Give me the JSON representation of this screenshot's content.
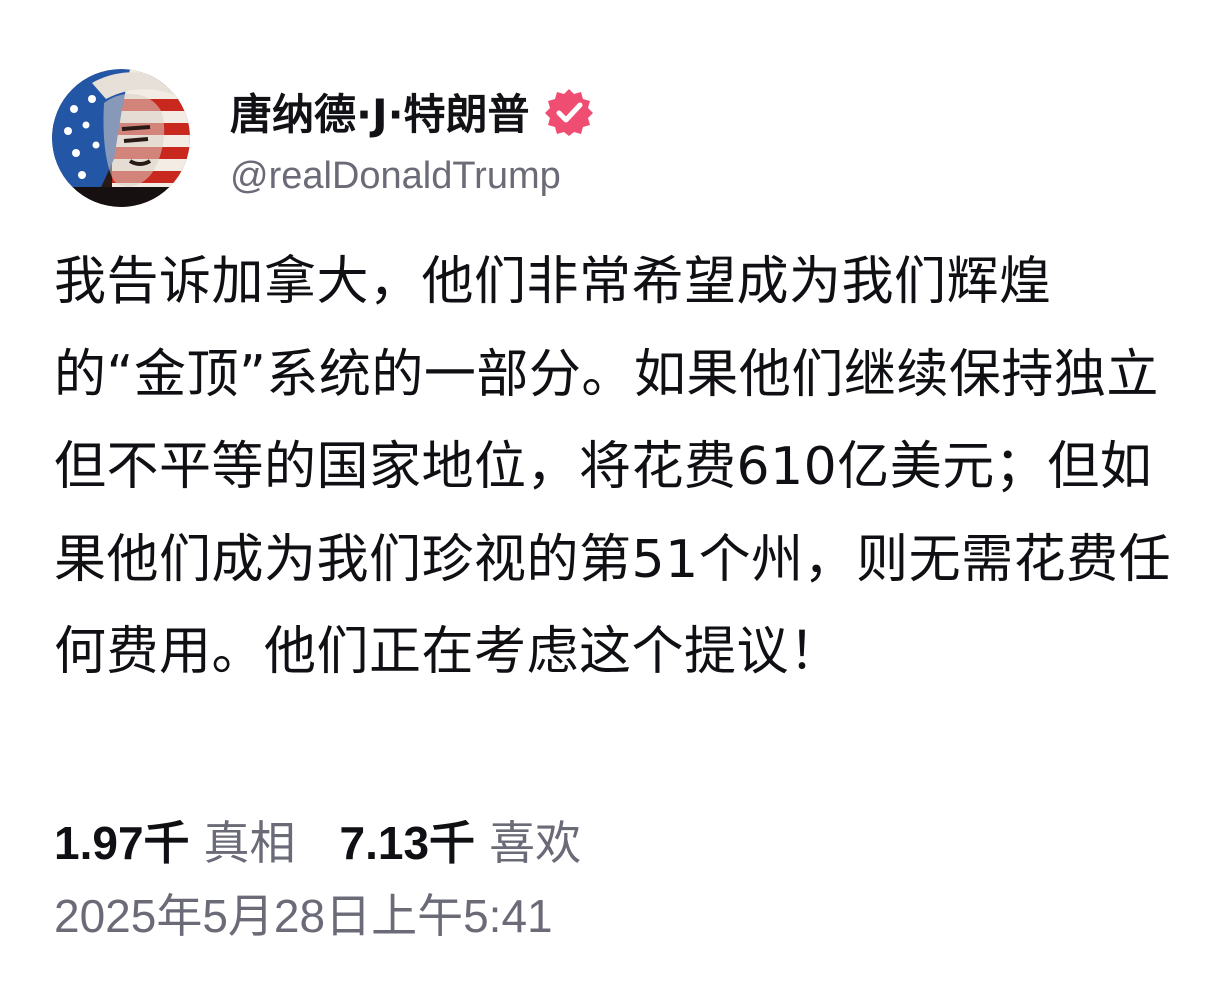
{
  "post": {
    "author": {
      "display_name": "唐纳德·J·特朗普",
      "handle": "@realDonaldTrump",
      "verified": true,
      "verified_badge_color": "#ef4d72",
      "avatar_icon": "flag-portrait-avatar"
    },
    "text": "我告诉加拿大，他们非常希望成为我们辉煌的“金顶”系统的一部分。如果他们继续保持独立但不平等的国家地位，将花费610亿美元；但如果他们成为我们珍视的第51个州，则无需花费任何费用。他们正在考虑这个提议！",
    "stats": {
      "truths_count": "1.97千",
      "truths_label": "真相",
      "likes_count": "7.13千",
      "likes_label": "喜欢"
    },
    "timestamp": "2025年5月28日上午5:41"
  },
  "colors": {
    "text_primary": "#0f0f14",
    "text_secondary": "#6b6b78",
    "background": "#ffffff"
  }
}
